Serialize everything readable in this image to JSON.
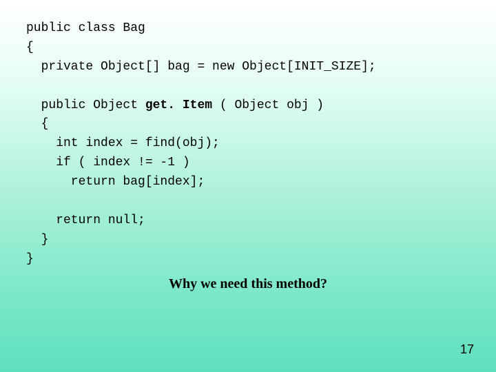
{
  "code": {
    "l1": "public class Bag",
    "l2": "{",
    "l3": "  private Object[] bag = new Object[INIT_SIZE];",
    "l4": "",
    "l5a": "  public Object ",
    "l5b": "get. Item",
    "l5c": " ( Object obj )",
    "l6": "  {",
    "l7": "    int index = find(obj);",
    "l8": "    if ( index != -1 )",
    "l9": "      return bag[index];",
    "l10": "",
    "l11": "    return null;",
    "l12": "  }",
    "l13": "}"
  },
  "question": "Why we need this method?",
  "page_number": "17"
}
